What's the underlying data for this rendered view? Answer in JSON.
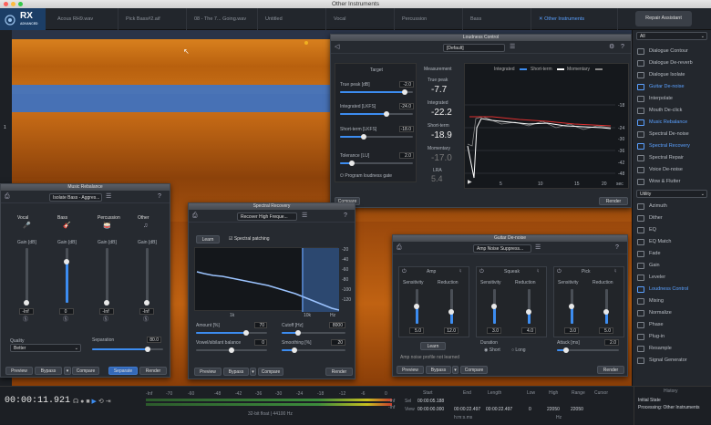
{
  "window": {
    "title": "Other Instruments"
  },
  "logo": {
    "text": "RX",
    "sub": "ADVANCED"
  },
  "tabs": [
    {
      "label": "Acous RH9.wav"
    },
    {
      "label": "Pick Bass#2.aif"
    },
    {
      "label": "08 - The 7... Going.wav"
    },
    {
      "label": "Untitled"
    },
    {
      "label": "Vocal"
    },
    {
      "label": "Percussion"
    },
    {
      "label": "Bass"
    },
    {
      "label": "Other Instruments"
    }
  ],
  "repair_assistant": "Repair Assistant",
  "freq_scale": {
    "label": "1"
  },
  "modules": {
    "filter": "All",
    "items": [
      "Dialogue Contour",
      "Dialogue De-reverb",
      "Dialogue Isolate",
      "Guitar De-noise",
      "Interpolate",
      "Mouth De-click",
      "Music Rebalance",
      "Spectral De-noise",
      "Spectral Recovery",
      "Spectral Repair",
      "Voice De-noise",
      "Wow & Flutter"
    ],
    "utility_label": "Utility",
    "utility": [
      "Azimuth",
      "Dither",
      "EQ",
      "EQ Match",
      "Fade",
      "Gain",
      "Leveler",
      "Loudness Control",
      "Mixing",
      "Normalize",
      "Phase",
      "Plug-in",
      "Resample",
      "Signal Generator"
    ]
  },
  "loudness": {
    "title": "Loudness Control",
    "preset": "[Default]",
    "target_label": "Target",
    "measurement_label": "Measurement",
    "rows": [
      {
        "label": "True peak [dB]",
        "value": "-2.0"
      },
      {
        "label": "Integrated [LKFS]",
        "value": "-24.0"
      },
      {
        "label": "Short-term [LKFS]",
        "value": "-18.0"
      },
      {
        "label": "Tolerance [LU]",
        "value": "2.0"
      }
    ],
    "gate": "Program loudness gate",
    "meas": [
      {
        "label": "True peak",
        "value": "-7.7"
      },
      {
        "label": "Integrated",
        "value": "-22.2"
      },
      {
        "label": "Short-term",
        "value": "-18.9"
      },
      {
        "label": "Momentary",
        "value": "-17.0"
      },
      {
        "label": "LRA",
        "value": "5.4"
      }
    ],
    "legend": [
      "Integrated",
      "Short-term",
      "Momentary"
    ],
    "y_ticks": [
      "-18",
      "-24",
      "-30",
      "-36",
      "-42",
      "-48"
    ],
    "x_ticks": [
      "5",
      "10",
      "15",
      "20"
    ],
    "x_unit": "sec",
    "compare": "Compare",
    "render": "Render"
  },
  "music_rebalance": {
    "title": "Music Rebalance",
    "preset": "Isolate Bass - Aggres...",
    "channels": [
      {
        "name": "Vocal",
        "gain_label": "Gain [dB]",
        "value": "-Inf",
        "level": 0.0
      },
      {
        "name": "Bass",
        "gain_label": "Gain [dB]",
        "value": "0",
        "level": 0.75
      },
      {
        "name": "Percussion",
        "gain_label": "Gain [dB]",
        "value": "-Inf",
        "level": 0.0
      },
      {
        "name": "Other",
        "gain_label": "Gain [dB]",
        "value": "-Inf",
        "level": 0.0
      }
    ],
    "quality_label": "Quality",
    "quality": "Better",
    "separation_label": "Separation",
    "separation": "80.0",
    "preview": "Preview",
    "bypass": "Bypass",
    "compare": "Compare",
    "separate": "Separate",
    "render": "Render"
  },
  "spectral_recovery": {
    "title": "Spectral Recovery",
    "preset": "Recover High Freque...",
    "learn": "Learn",
    "patching": "Spectral patching",
    "y_ticks": [
      "-20",
      "-40",
      "-60",
      "-80",
      "-100",
      "-120"
    ],
    "x_ticks": [
      "1k",
      "10k",
      "Hz"
    ],
    "amount_label": "Amount [%]",
    "amount": "70",
    "cutoff_label": "Cutoff [Hz]",
    "cutoff": "8000",
    "vowel_label": "Vowel/sibilant balance",
    "vowel": "0",
    "smoothing_label": "Smoothing [%]",
    "smoothing": "20",
    "preview": "Preview",
    "bypass": "Bypass",
    "compare": "Compare",
    "render": "Render"
  },
  "guitar_denoise": {
    "title": "Guitar De-noise",
    "preset": "Amp Noise Suppress...",
    "sections": [
      {
        "name": "Amp",
        "s": "5.0",
        "r": "12.0"
      },
      {
        "name": "Squeak",
        "s": "3.0",
        "r": "4.0"
      },
      {
        "name": "Pick",
        "s": "3.0",
        "r": "5.0"
      }
    ],
    "sens_label": "Sensitivity",
    "red_label": "Reduction",
    "learn": "Learn",
    "profile": "Amp noise profile not learned",
    "duration_label": "Duration",
    "short": "Short",
    "long": "Long",
    "attack_label": "Attack [ms]",
    "attack": "2.0",
    "preview": "Preview",
    "bypass": "Bypass",
    "compare": "Compare",
    "render": "Render"
  },
  "transport": {
    "time": "00:00:11.921",
    "meter_ticks": [
      "-Inf",
      "-70",
      "-60",
      "-48",
      "-42",
      "-36",
      "-30",
      "-24",
      "-18",
      "-12",
      "-6",
      "0"
    ],
    "format": "32-bit float | 44100 Hz",
    "rms_l": "-Inf",
    "rms_r": "-Inf"
  },
  "selection": {
    "headers": [
      "Start",
      "End",
      "Length",
      "Low",
      "High",
      "Range",
      "Cursor"
    ],
    "sel_label": "Sel",
    "view_label": "View",
    "sel": [
      "00:00:05.188",
      "",
      "",
      "",
      "",
      "",
      ""
    ],
    "view": [
      "00:00:00.000",
      "00:00:22.497",
      "00:00:22.497",
      "0",
      "22050",
      "22050",
      ""
    ],
    "unit": "h:m:s.ms",
    "hz": "Hz"
  },
  "history": {
    "title": "History",
    "items": [
      "Initial State",
      "Processing: Other Instruments"
    ]
  }
}
